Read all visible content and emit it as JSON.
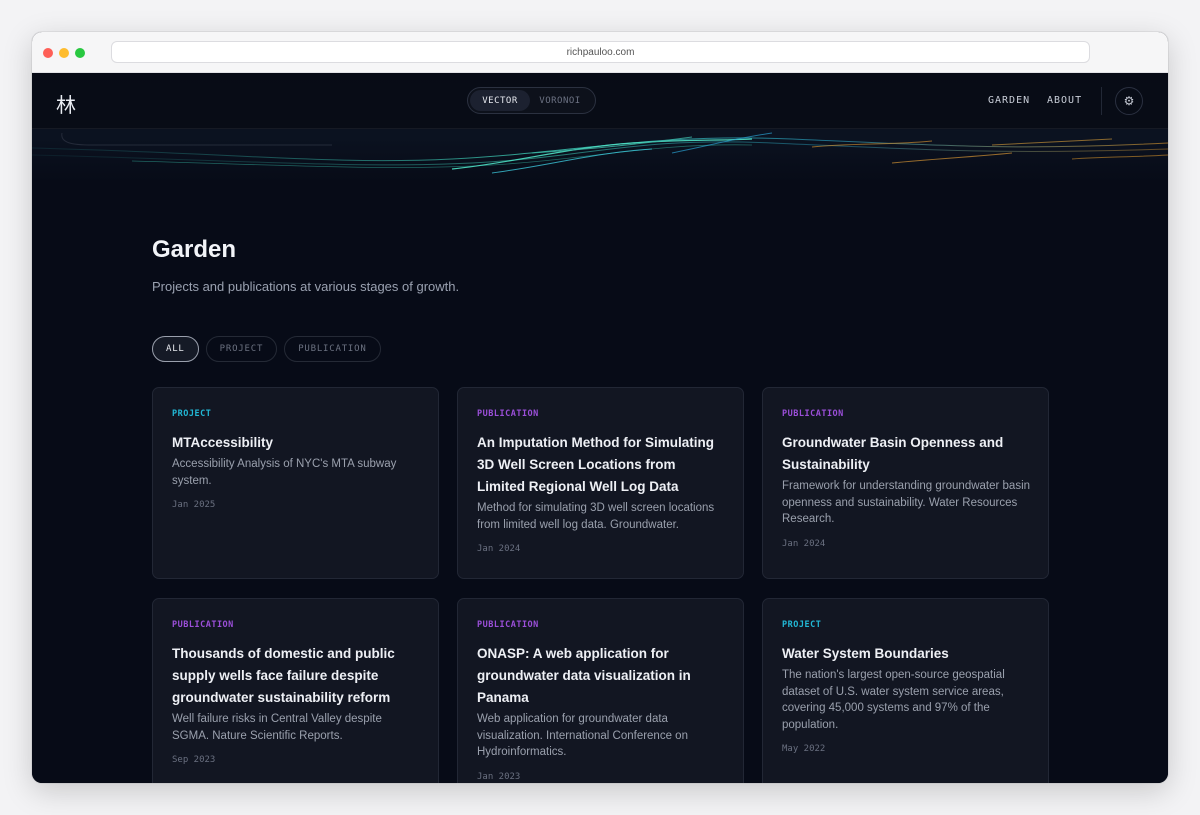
{
  "browser": {
    "url": "richpauloo.com"
  },
  "nav": {
    "logo": "林",
    "toggle": {
      "vector": "VECTOR",
      "voronoi": "VORONOI"
    },
    "links": {
      "garden": "GARDEN",
      "about": "ABOUT"
    },
    "settings_icon": "⚙"
  },
  "header": {
    "title": "Garden",
    "subtitle": "Projects and publications at various stages of growth."
  },
  "filters": {
    "all": "ALL",
    "project": "PROJECT",
    "publication": "PUBLICATION",
    "selected": "ALL"
  },
  "cards": [
    {
      "tag": "PROJECT",
      "title": "MTAccessibility",
      "description": "Accessibility Analysis of NYC's MTA subway system.",
      "date": "Jan 2025"
    },
    {
      "tag": "PUBLICATION",
      "title": "An Imputation Method for Simulating 3D Well Screen Locations from Limited Regional Well Log Data",
      "description": "Method for simulating 3D well screen locations from limited well log data. Groundwater.",
      "date": "Jan 2024"
    },
    {
      "tag": "PUBLICATION",
      "title": "Groundwater Basin Openness and Sustainability",
      "description": "Framework for understanding groundwater basin openness and sustainability. Water Resources Research.",
      "date": "Jan 2024"
    },
    {
      "tag": "PUBLICATION",
      "title": "Thousands of domestic and public supply wells face failure despite groundwater sustainability reform",
      "description": "Well failure risks in Central Valley despite SGMA. Nature Scientific Reports.",
      "date": "Sep 2023"
    },
    {
      "tag": "PUBLICATION",
      "title": "ONASP: A web application for groundwater data visualization in Panama",
      "description": "Web application for groundwater data visualization. International Conference on Hydroinformatics.",
      "date": "Jan 2023"
    },
    {
      "tag": "PROJECT",
      "title": "Water System Boundaries",
      "description": "The nation's largest open-source geospatial dataset of U.S. water system service areas, covering 45,000 systems and 97% of the population.",
      "date": "May 2022"
    }
  ],
  "colors": {
    "project_tag": "#22b8d6",
    "publication_tag": "#9b4fd9",
    "background": "#070b17",
    "card": "#121622"
  }
}
